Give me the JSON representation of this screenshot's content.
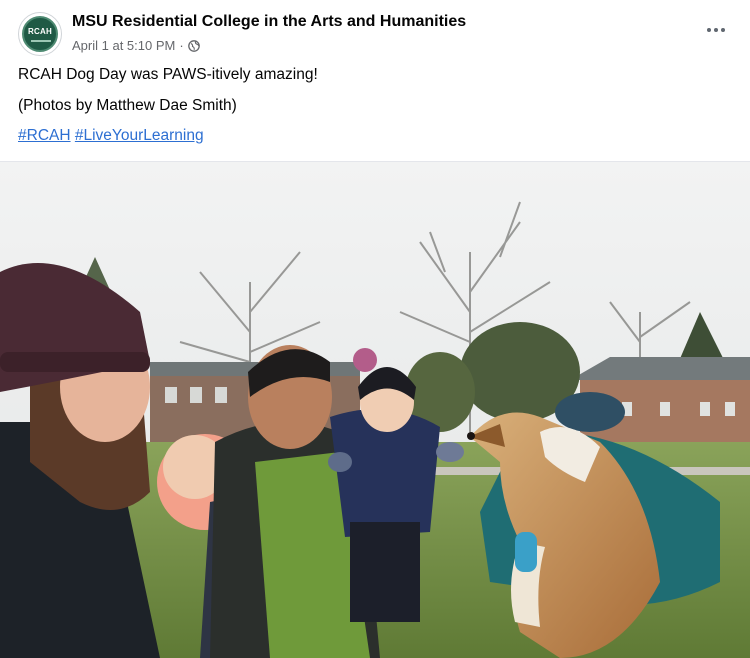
{
  "post": {
    "page_name": "MSU Residential College in the Arts and Humanities",
    "timestamp": "April 1 at 5:10 PM",
    "separator": "·",
    "avatar_text": "RCAH",
    "privacy_icon": "globe-icon",
    "more_icon": "more-horizontal-icon",
    "line1": "RCAH Dog Day was PAWS-itively amazing!",
    "line2": "(Photos by Matthew Dae Smith)",
    "hashtags": [
      "#RCAH",
      "#LiveYourLearning"
    ]
  },
  "colors": {
    "link": "#2d6fd2",
    "meta": "#65676b",
    "text": "#050505",
    "avatar_bg": "#1f5a45"
  }
}
